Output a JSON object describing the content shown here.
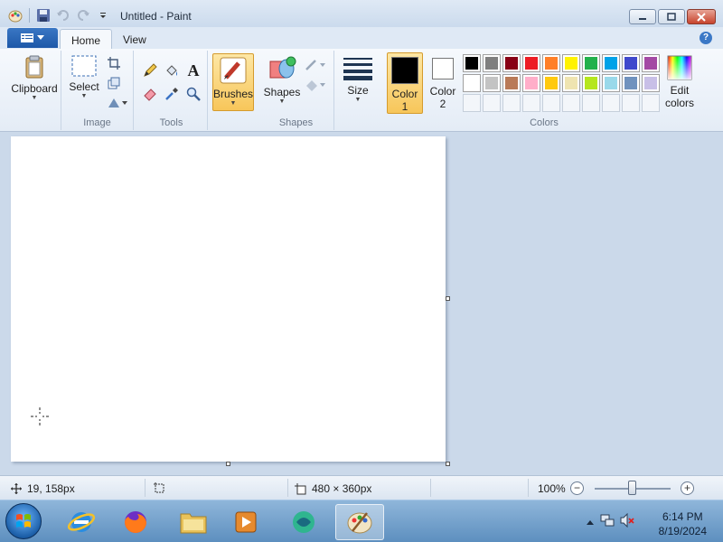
{
  "window": {
    "title": "Untitled - Paint"
  },
  "tabs": {
    "home": "Home",
    "view": "View",
    "help": "?"
  },
  "ribbon": {
    "clipboard": {
      "label": "Clipboard"
    },
    "image": {
      "select_label": "Select",
      "group_label": "Image"
    },
    "tools": {
      "group_label": "Tools",
      "text_tool": "A"
    },
    "brushes": {
      "label": "Brushes"
    },
    "shapes": {
      "label": "Shapes",
      "group_label": "Shapes"
    },
    "size": {
      "label": "Size"
    },
    "color1": {
      "label_line1": "Color",
      "label_line2": "1",
      "value": "#000000"
    },
    "color2": {
      "label_line1": "Color",
      "label_line2": "2",
      "value": "#ffffff"
    },
    "colors_group_label": "Colors",
    "edit_colors": {
      "line1": "Edit",
      "line2": "colors"
    },
    "palette_row1": [
      "#000000",
      "#7f7f7f",
      "#880015",
      "#ed1c24",
      "#ff7f27",
      "#fff200",
      "#22b14c",
      "#00a2e8",
      "#3f48cc",
      "#a349a4"
    ],
    "palette_row2": [
      "#ffffff",
      "#c3c3c3",
      "#b97a57",
      "#ffaec9",
      "#ffc90e",
      "#efe4b0",
      "#b5e61d",
      "#99d9ea",
      "#7092be",
      "#c8bfe7"
    ]
  },
  "status": {
    "cursor_pos": "19, 158px",
    "canvas_size": "480 × 360px",
    "zoom": "100%",
    "zoom_slider_value": 100
  },
  "taskbar": {
    "time": "6:14 PM",
    "date": "8/19/2024"
  },
  "colors": {
    "accent_blue": "#1d58a8",
    "highlight_orange": "#f7c65a",
    "workspace_bg": "#cbd9ea"
  }
}
